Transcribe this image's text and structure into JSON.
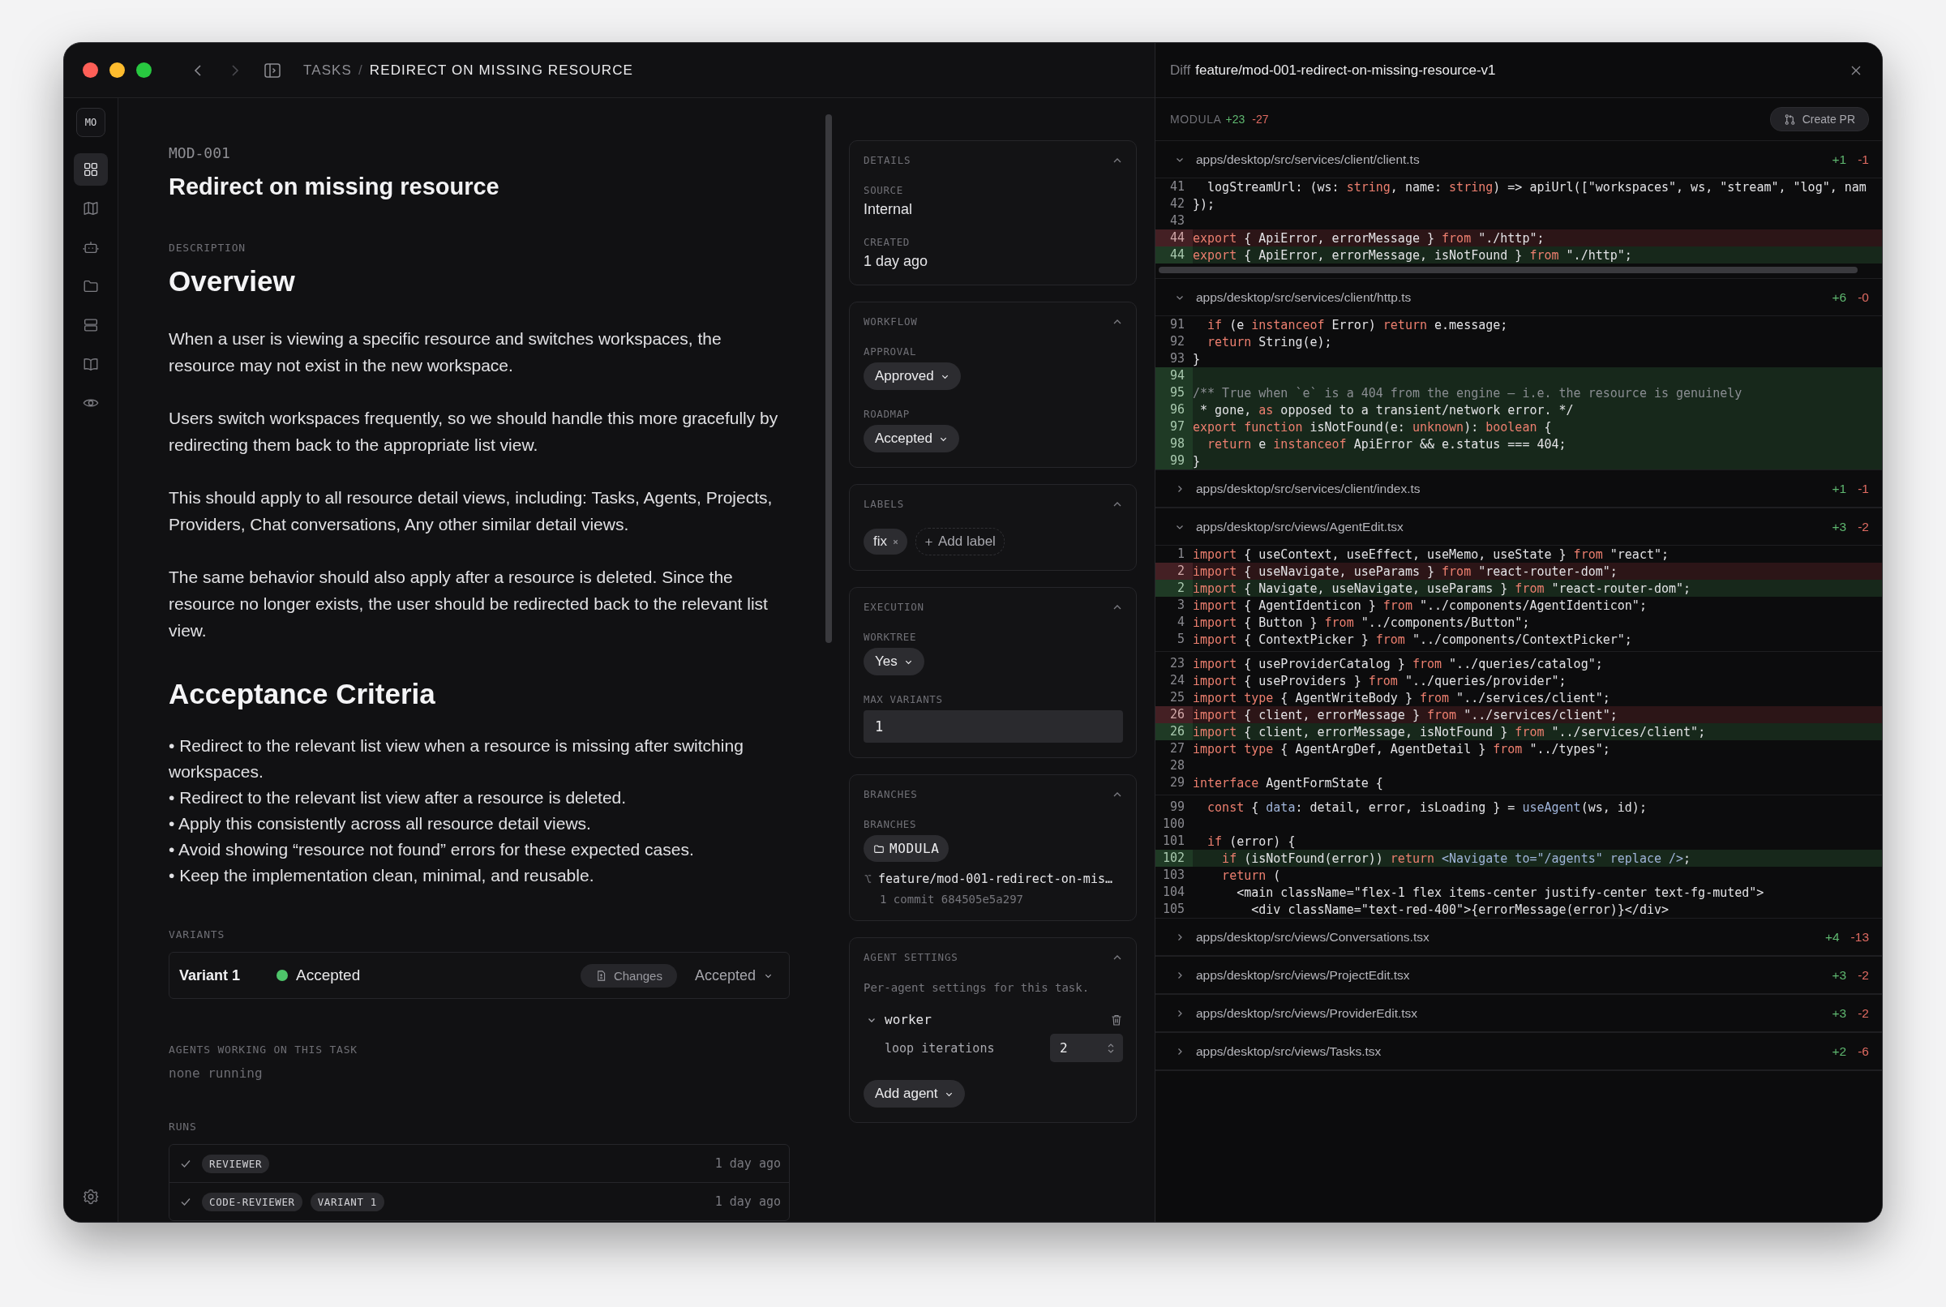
{
  "titlebar": {
    "navigation": [
      {
        "kind": "back",
        "disabled": false
      },
      {
        "kind": "forward",
        "disabled": true
      }
    ],
    "breadcrumb": [
      {
        "text": "TASKS",
        "selected": false
      },
      {
        "text": "REDIRECT ON MISSING RESOURCE",
        "selected": true
      }
    ],
    "separator": "/"
  },
  "sidebar": {
    "workspace": "MO",
    "items": [
      {
        "kind": "grid",
        "selected": true
      },
      {
        "kind": "map",
        "selected": false
      },
      {
        "kind": "bot",
        "selected": false
      },
      {
        "kind": "folder",
        "selected": false
      },
      {
        "kind": "server",
        "selected": false
      },
      {
        "kind": "book",
        "selected": false
      },
      {
        "kind": "eye",
        "selected": false
      }
    ]
  },
  "task": {
    "id": "MOD-001",
    "title": "Redirect on missing resource",
    "description_label": "DESCRIPTION",
    "blocks": [
      {
        "kind": "heading",
        "text": "Overview"
      },
      {
        "kind": "paragraph",
        "text": "When a user is viewing a specific resource and switches workspaces, the resource may not exist in the new workspace."
      },
      {
        "kind": "paragraph",
        "text": "Users switch workspaces frequently, so we should handle this more gracefully by redirecting them back to the appropriate list view."
      },
      {
        "kind": "paragraph",
        "text": "This should apply to all resource detail views, including: Tasks, Agents, Projects, Providers, Chat conversations, Any other similar detail views."
      },
      {
        "kind": "paragraph",
        "text": "The same behavior should also apply after a resource is deleted. Since the resource no longer exists, the user should be redirected back to the relevant list view."
      },
      {
        "kind": "heading",
        "text": "Acceptance Criteria"
      },
      {
        "kind": "list",
        "items": [
          "• Redirect to the relevant list view when a resource is missing after switching workspaces.",
          "• Redirect to the relevant list view after a resource is deleted.",
          "• Apply this consistently across all resource detail views.",
          "• Avoid showing “resource not found” errors for these expected cases.",
          "• Keep the implementation clean, minimal, and reusable."
        ]
      }
    ]
  },
  "variants": {
    "label": "VARIANTS",
    "items": [
      {
        "name": "Variant 1",
        "status": "Accepted",
        "color": "#4ec46a",
        "changes_button": "Changes",
        "decision": "Accepted"
      }
    ]
  },
  "agents_working": {
    "label": "AGENTS WORKING ON THIS TASK",
    "text": "none running"
  },
  "runs": {
    "label": "RUNS",
    "items": [
      {
        "done": true,
        "tags": [
          "REVIEWER"
        ],
        "time": "1 day ago"
      },
      {
        "done": true,
        "tags": [
          "CODE-REVIEWER",
          "VARIANT 1"
        ],
        "time": "1 day ago"
      }
    ]
  },
  "panels": [
    {
      "title": "DETAILS",
      "expanded": true,
      "fields": [
        {
          "kind": "text",
          "label": "SOURCE",
          "value": "Internal"
        },
        {
          "kind": "text",
          "label": "CREATED",
          "value": "1 day ago"
        }
      ]
    },
    {
      "title": "WORKFLOW",
      "expanded": true,
      "fields": [
        {
          "kind": "select",
          "label": "APPROVAL",
          "value": "Approved"
        },
        {
          "kind": "select",
          "label": "ROADMAP",
          "value": "Accepted"
        }
      ]
    },
    {
      "title": "LABELS",
      "expanded": true,
      "fields": [
        {
          "kind": "tags",
          "tags": [
            "fix"
          ],
          "add": "Add label"
        }
      ]
    },
    {
      "title": "EXECUTION",
      "expanded": true,
      "fields": [
        {
          "kind": "select",
          "label": "WORKTREE",
          "value": "Yes"
        },
        {
          "kind": "input",
          "label": "MAX VARIANTS",
          "value": "1"
        }
      ]
    },
    {
      "title": "BRANCHES",
      "expanded": true,
      "fields": [
        {
          "kind": "branches",
          "label": "BRANCHES",
          "repo": "MODULA",
          "branch": "feature/mod-001-redirect-on-mis…",
          "commit": "1 commit 684505e5a297"
        }
      ]
    },
    {
      "title": "AGENT SETTINGS",
      "expanded": true,
      "fields": [
        {
          "kind": "note",
          "value": "Per-agent settings for this task."
        },
        {
          "kind": "agent",
          "name": "worker",
          "expanded": true,
          "setting": "loop iterations",
          "value": "2"
        },
        {
          "kind": "button",
          "value": "Add agent"
        }
      ]
    }
  ],
  "diff": {
    "label": "Diff",
    "branch": "feature/mod-001-redirect-on-missing-resource-v1",
    "repo": "MODULA",
    "added": "+23",
    "removed": "-27",
    "create_pr": "Create PR",
    "files": [
      {
        "path": "apps/desktop/src/services/client/client.ts",
        "added": "+1",
        "removed": "-1",
        "expanded": true,
        "scrollbar": true,
        "hunks": [
          {
            "lines": [
              {
                "num": "41",
                "kind": "context",
                "segments": [
                  {
                    "kind": "plain",
                    "text": "  logStreamUrl: (ws: "
                  },
                  {
                    "kind": "kw",
                    "text": "string"
                  },
                  {
                    "kind": "plain",
                    "text": ", name: "
                  },
                  {
                    "kind": "kw",
                    "text": "string"
                  },
                  {
                    "kind": "plain",
                    "text": ") => apiUrl([\"workspaces\", ws, \"stream\", \"log\", nam"
                  }
                ]
              },
              {
                "num": "42",
                "kind": "context",
                "segments": [
                  {
                    "kind": "plain",
                    "text": "});"
                  }
                ]
              },
              {
                "num": "43",
                "kind": "context"
              },
              {
                "num": "44",
                "kind": "removed",
                "segments": [
                  {
                    "kind": "kw",
                    "text": "export"
                  },
                  {
                    "kind": "plain",
                    "text": " { ApiError, errorMessage } "
                  },
                  {
                    "kind": "kw",
                    "text": "from"
                  },
                  {
                    "kind": "plain",
                    "text": " \"./http\";"
                  }
                ]
              },
              {
                "num": "44",
                "kind": "added",
                "segments": [
                  {
                    "kind": "kw",
                    "text": "export"
                  },
                  {
                    "kind": "plain",
                    "text": " { ApiError, errorMessage, isNotFound } "
                  },
                  {
                    "kind": "kw",
                    "text": "from"
                  },
                  {
                    "kind": "plain",
                    "text": " \"./http\";"
                  }
                ]
              }
            ]
          }
        ]
      },
      {
        "path": "apps/desktop/src/services/client/http.ts",
        "added": "+6",
        "removed": "-0",
        "expanded": true,
        "hunks": [
          {
            "lines": [
              {
                "num": "91",
                "kind": "context",
                "segments": [
                  {
                    "kind": "kw",
                    "text": "  if"
                  },
                  {
                    "kind": "plain",
                    "text": " (e "
                  },
                  {
                    "kind": "kw",
                    "text": "instanceof"
                  },
                  {
                    "kind": "plain",
                    "text": " Error) "
                  },
                  {
                    "kind": "kw",
                    "text": "return"
                  },
                  {
                    "kind": "plain",
                    "text": " e.message;"
                  }
                ]
              },
              {
                "num": "92",
                "kind": "context",
                "segments": [
                  {
                    "kind": "kw",
                    "text": "  return"
                  },
                  {
                    "kind": "plain",
                    "text": " String(e);"
                  }
                ]
              },
              {
                "num": "93",
                "kind": "context",
                "segments": [
                  {
                    "kind": "plain",
                    "text": "}"
                  }
                ]
              },
              {
                "num": "94",
                "kind": "added"
              },
              {
                "num": "95",
                "kind": "added",
                "segments": [
                  {
                    "kind": "cm",
                    "text": "/** True when `e` is a 404 from the engine — i.e. the resource is genuinely"
                  }
                ]
              },
              {
                "num": "96",
                "kind": "added",
                "segments": [
                  {
                    "kind": "plain",
                    "text": " * gone, "
                  },
                  {
                    "kind": "kw",
                    "text": "as"
                  },
                  {
                    "kind": "plain",
                    "text": " opposed to a transient/network error. */"
                  }
                ]
              },
              {
                "num": "97",
                "kind": "added",
                "segments": [
                  {
                    "kind": "kw",
                    "text": "export function"
                  },
                  {
                    "kind": "plain",
                    "text": " isNotFound(e: "
                  },
                  {
                    "kind": "kw",
                    "text": "unknown"
                  },
                  {
                    "kind": "plain",
                    "text": "): "
                  },
                  {
                    "kind": "kw",
                    "text": "boolean"
                  },
                  {
                    "kind": "plain",
                    "text": " {"
                  }
                ]
              },
              {
                "num": "98",
                "kind": "added",
                "segments": [
                  {
                    "kind": "kw",
                    "text": "  return"
                  },
                  {
                    "kind": "plain",
                    "text": " e "
                  },
                  {
                    "kind": "kw",
                    "text": "instanceof"
                  },
                  {
                    "kind": "plain",
                    "text": " ApiError && e.status === 404;"
                  }
                ]
              },
              {
                "num": "99",
                "kind": "added",
                "segments": [
                  {
                    "kind": "plain",
                    "text": "}"
                  }
                ]
              }
            ]
          }
        ]
      },
      {
        "path": "apps/desktop/src/services/client/index.ts",
        "added": "+1",
        "removed": "-1",
        "expanded": false
      },
      {
        "path": "apps/desktop/src/views/AgentEdit.tsx",
        "added": "+3",
        "removed": "-2",
        "expanded": true,
        "hunks": [
          {
            "lines": [
              {
                "num": "1",
                "kind": "context",
                "segments": [
                  {
                    "kind": "kw",
                    "text": "import"
                  },
                  {
                    "kind": "plain",
                    "text": " { useContext, useEffect, useMemo, useState } "
                  },
                  {
                    "kind": "kw",
                    "text": "from"
                  },
                  {
                    "kind": "plain",
                    "text": " \"react\";"
                  }
                ]
              },
              {
                "num": "2",
                "kind": "removed",
                "segments": [
                  {
                    "kind": "kw",
                    "text": "import"
                  },
                  {
                    "kind": "plain",
                    "text": " { useNavigate, useParams } "
                  },
                  {
                    "kind": "kw",
                    "text": "from"
                  },
                  {
                    "kind": "plain",
                    "text": " \"react-router-dom\";"
                  }
                ]
              },
              {
                "num": "2",
                "kind": "added",
                "segments": [
                  {
                    "kind": "kw",
                    "text": "import"
                  },
                  {
                    "kind": "plain",
                    "text": " { Navigate, useNavigate, useParams } "
                  },
                  {
                    "kind": "kw",
                    "text": "from"
                  },
                  {
                    "kind": "plain",
                    "text": " \"react-router-dom\";"
                  }
                ]
              },
              {
                "num": "3",
                "kind": "context",
                "segments": [
                  {
                    "kind": "kw",
                    "text": "import"
                  },
                  {
                    "kind": "plain",
                    "text": " { AgentIdenticon } "
                  },
                  {
                    "kind": "kw",
                    "text": "from"
                  },
                  {
                    "kind": "plain",
                    "text": " \"../components/AgentIdenticon\";"
                  }
                ]
              },
              {
                "num": "4",
                "kind": "context",
                "segments": [
                  {
                    "kind": "kw",
                    "text": "import"
                  },
                  {
                    "kind": "plain",
                    "text": " { Button } "
                  },
                  {
                    "kind": "kw",
                    "text": "from"
                  },
                  {
                    "kind": "plain",
                    "text": " \"../components/Button\";"
                  }
                ]
              },
              {
                "num": "5",
                "kind": "context",
                "segments": [
                  {
                    "kind": "kw",
                    "text": "import"
                  },
                  {
                    "kind": "plain",
                    "text": " { ContextPicker } "
                  },
                  {
                    "kind": "kw",
                    "text": "from"
                  },
                  {
                    "kind": "plain",
                    "text": " \"../components/ContextPicker\";"
                  }
                ]
              }
            ]
          },
          {
            "lines": [
              {
                "num": "23",
                "kind": "context",
                "segments": [
                  {
                    "kind": "kw",
                    "text": "import"
                  },
                  {
                    "kind": "plain",
                    "text": " { useProviderCatalog } "
                  },
                  {
                    "kind": "kw",
                    "text": "from"
                  },
                  {
                    "kind": "plain",
                    "text": " \"../queries/catalog\";"
                  }
                ]
              },
              {
                "num": "24",
                "kind": "context",
                "segments": [
                  {
                    "kind": "kw",
                    "text": "import"
                  },
                  {
                    "kind": "plain",
                    "text": " { useProviders } "
                  },
                  {
                    "kind": "kw",
                    "text": "from"
                  },
                  {
                    "kind": "plain",
                    "text": " \"../queries/provider\";"
                  }
                ]
              },
              {
                "num": "25",
                "kind": "context",
                "segments": [
                  {
                    "kind": "kw",
                    "text": "import type"
                  },
                  {
                    "kind": "plain",
                    "text": " { AgentWriteBody } "
                  },
                  {
                    "kind": "kw",
                    "text": "from"
                  },
                  {
                    "kind": "plain",
                    "text": " \"../services/client\";"
                  }
                ]
              },
              {
                "num": "26",
                "kind": "removed",
                "segments": [
                  {
                    "kind": "kw",
                    "text": "import"
                  },
                  {
                    "kind": "plain",
                    "text": " { client, errorMessage } "
                  },
                  {
                    "kind": "kw",
                    "text": "from"
                  },
                  {
                    "kind": "plain",
                    "text": " \"../services/client\";"
                  }
                ]
              },
              {
                "num": "26",
                "kind": "added",
                "segments": [
                  {
                    "kind": "kw",
                    "text": "import"
                  },
                  {
                    "kind": "plain",
                    "text": " { client, errorMessage, isNotFound } "
                  },
                  {
                    "kind": "kw",
                    "text": "from"
                  },
                  {
                    "kind": "plain",
                    "text": " \"../services/client\";"
                  }
                ]
              },
              {
                "num": "27",
                "kind": "context",
                "segments": [
                  {
                    "kind": "kw",
                    "text": "import type"
                  },
                  {
                    "kind": "plain",
                    "text": " { AgentArgDef, AgentDetail } "
                  },
                  {
                    "kind": "kw",
                    "text": "from"
                  },
                  {
                    "kind": "plain",
                    "text": " \"../types\";"
                  }
                ]
              },
              {
                "num": "28",
                "kind": "context"
              },
              {
                "num": "29",
                "kind": "context",
                "segments": [
                  {
                    "kind": "kw",
                    "text": "interface"
                  },
                  {
                    "kind": "plain",
                    "text": " AgentFormState {"
                  }
                ]
              }
            ]
          },
          {
            "lines": [
              {
                "num": "99",
                "kind": "context",
                "segments": [
                  {
                    "kind": "kw",
                    "text": "  const"
                  },
                  {
                    "kind": "plain",
                    "text": " { "
                  },
                  {
                    "kind": "fn",
                    "text": "data"
                  },
                  {
                    "kind": "plain",
                    "text": ": detail, error, isLoading } = "
                  },
                  {
                    "kind": "fn",
                    "text": "useAgent"
                  },
                  {
                    "kind": "plain",
                    "text": "(ws, id);"
                  }
                ]
              },
              {
                "num": "100",
                "kind": "context"
              },
              {
                "num": "101",
                "kind": "context",
                "segments": [
                  {
                    "kind": "kw",
                    "text": "  if"
                  },
                  {
                    "kind": "plain",
                    "text": " (error) {"
                  }
                ]
              },
              {
                "num": "102",
                "kind": "added",
                "segments": [
                  {
                    "kind": "kw",
                    "text": "    if"
                  },
                  {
                    "kind": "plain",
                    "text": " (isNotFound(error)) "
                  },
                  {
                    "kind": "kw",
                    "text": "return"
                  },
                  {
                    "kind": "fn",
                    "text": " <Navigate to=\"/agents\" replace />"
                  },
                  {
                    "kind": "plain",
                    "text": ";"
                  }
                ]
              },
              {
                "num": "103",
                "kind": "context",
                "segments": [
                  {
                    "kind": "kw",
                    "text": "    return"
                  },
                  {
                    "kind": "plain",
                    "text": " ("
                  }
                ]
              },
              {
                "num": "104",
                "kind": "context",
                "segments": [
                  {
                    "kind": "plain",
                    "text": "      <main className=\"flex-1 flex items-center justify-center text-fg-muted\">"
                  }
                ]
              },
              {
                "num": "105",
                "kind": "context",
                "segments": [
                  {
                    "kind": "plain",
                    "text": "        <div className=\"text-red-400\">{errorMessage(error)}</div>"
                  }
                ]
              }
            ]
          }
        ]
      },
      {
        "path": "apps/desktop/src/views/Conversations.tsx",
        "added": "+4",
        "removed": "-13",
        "expanded": false
      },
      {
        "path": "apps/desktop/src/views/ProjectEdit.tsx",
        "added": "+3",
        "removed": "-2",
        "expanded": false
      },
      {
        "path": "apps/desktop/src/views/ProviderEdit.tsx",
        "added": "+3",
        "removed": "-2",
        "expanded": false
      },
      {
        "path": "apps/desktop/src/views/Tasks.tsx",
        "added": "+2",
        "removed": "-6",
        "expanded": false
      }
    ]
  }
}
